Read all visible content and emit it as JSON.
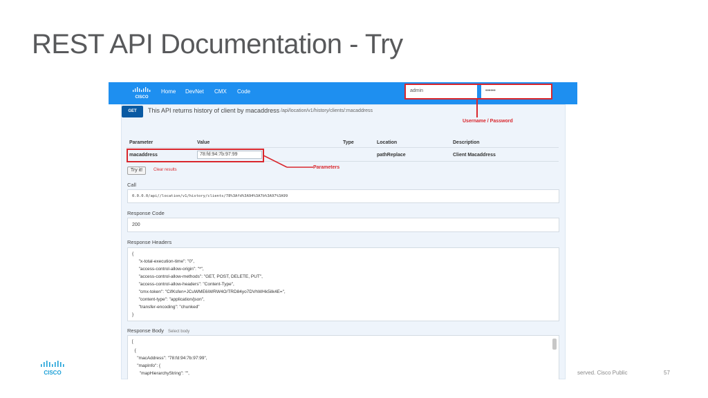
{
  "slide": {
    "title": "REST API Documentation - Try",
    "footer_text": "served.   Cisco Public",
    "page_number": "57",
    "footer_logo_text": "CISCO"
  },
  "navbar": {
    "logo_text": "CISCO",
    "links": [
      "Home",
      "DevNet",
      "CMX",
      "Code"
    ],
    "username": "admin",
    "password": "••••••"
  },
  "endpoint": {
    "method": "GET",
    "description": "This API returns history of client by macaddress",
    "path": "/api/location/v1/history/clients/:macaddress"
  },
  "params_table": {
    "headers": [
      "Parameter",
      "Value",
      "Type",
      "Location",
      "Description"
    ],
    "row": {
      "parameter": "macaddress",
      "value": "78:fd:94:7b:97:99",
      "location": "pathReplace",
      "description": "Client Macaddress"
    }
  },
  "actions": {
    "try_label": "Try it!",
    "clear_label": "Clear results"
  },
  "call": {
    "label": "Call",
    "url": "0.0.0.0/api//location/v1/history/clients/78%3Afd%3A94%3A7b%3A97%3A99"
  },
  "response_code": {
    "label": "Response Code",
    "value": "200"
  },
  "response_headers": {
    "label": "Response Headers",
    "lines": [
      "{",
      "  \"x-total-execution-time\": \"0\",",
      "  \"access-control-allow-origin\": \"*\",",
      "  \"access-control-allow-methods\": \"GET, POST, DELETE, PUT\",",
      "  \"access-control-allow-headers\": \"Content-Type\",",
      "  \"cmx-token\": \"CifKsfen+JCuWME6iWRW4O/TRD84yo7DVhWHk5ilk4E=\",",
      "  \"content-type\": \"application/json\",",
      "  \"transfer-encoding\": \"chunked\"",
      "}"
    ]
  },
  "response_body": {
    "label": "Response Body",
    "select_label": "Select body",
    "lines": [
      "[",
      "  {",
      "    \"macAddress\": \"78:fd:94:7b:97:99\",",
      "    \"mapInfo\": {",
      "      \"mapHierarchyString\": \"\","
    ]
  },
  "annotations": {
    "credentials": "Username / Password",
    "parameters": "Parameters"
  },
  "colors": {
    "navbar": "#1e8ff0",
    "annotation_red": "#d9262c",
    "get_badge": "#0a5aa3"
  }
}
